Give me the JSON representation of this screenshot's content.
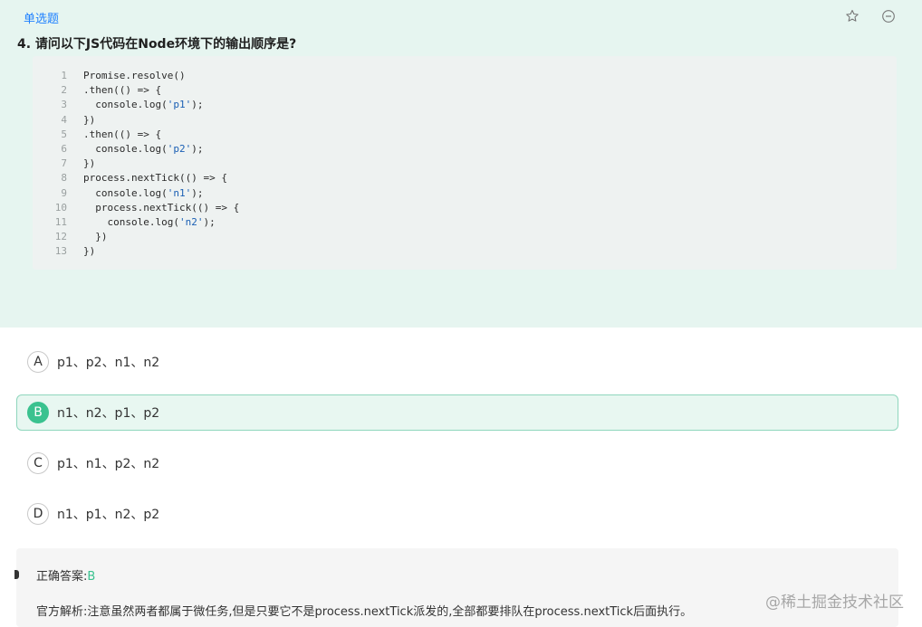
{
  "question": {
    "type_label": "单选题",
    "title": "4. 请问以下JS代码在Node环境下的输出顺序是?",
    "code_lines": [
      {
        "n": "1",
        "segments": [
          {
            "t": "Promise.resolve()"
          }
        ]
      },
      {
        "n": "2",
        "segments": [
          {
            "t": ".then(() => {"
          }
        ]
      },
      {
        "n": "3",
        "segments": [
          {
            "t": "  console.log("
          },
          {
            "t": "'p1'",
            "s": 1
          },
          {
            "t": ");"
          }
        ]
      },
      {
        "n": "4",
        "segments": [
          {
            "t": "})"
          }
        ]
      },
      {
        "n": "5",
        "segments": [
          {
            "t": ".then(() => {"
          }
        ]
      },
      {
        "n": "6",
        "segments": [
          {
            "t": "  console.log("
          },
          {
            "t": "'p2'",
            "s": 1
          },
          {
            "t": ");"
          }
        ]
      },
      {
        "n": "7",
        "segments": [
          {
            "t": "})"
          }
        ]
      },
      {
        "n": "8",
        "segments": [
          {
            "t": "process.nextTick(() => {"
          }
        ]
      },
      {
        "n": "9",
        "segments": [
          {
            "t": "  console.log("
          },
          {
            "t": "'n1'",
            "s": 1
          },
          {
            "t": ");"
          }
        ]
      },
      {
        "n": "10",
        "segments": [
          {
            "t": "  process.nextTick(() => {"
          }
        ]
      },
      {
        "n": "11",
        "segments": [
          {
            "t": "    console.log("
          },
          {
            "t": "'n2'",
            "s": 1
          },
          {
            "t": ");"
          }
        ]
      },
      {
        "n": "12",
        "segments": [
          {
            "t": "  })"
          }
        ]
      },
      {
        "n": "13",
        "segments": [
          {
            "t": "})"
          }
        ]
      }
    ]
  },
  "icons": {
    "favorite": "star-outline-icon",
    "collapse": "minus-circle-icon"
  },
  "options": [
    {
      "letter": "A",
      "text": "p1、p2、n1、n2",
      "selected": false
    },
    {
      "letter": "B",
      "text": "n1、n2、p1、p2",
      "selected": true
    },
    {
      "letter": "C",
      "text": "p1、n1、p2、n2",
      "selected": false
    },
    {
      "letter": "D",
      "text": "n1、p1、n2、p2",
      "selected": false
    }
  ],
  "answer": {
    "correct_label": "正确答案:",
    "correct_value": "B",
    "explanation": "官方解析:注意虽然两者都属于微任务,但是只要它不是process.nextTick派发的,全部都要排队在process.nextTick后面执行。"
  },
  "watermark": "@稀土掘金技术社区",
  "colors": {
    "accent_green": "#3ac28f",
    "type_tag_blue": "#1e80ff",
    "question_bg": "#e6f5f0",
    "string_blue": "#1a5fb4"
  }
}
